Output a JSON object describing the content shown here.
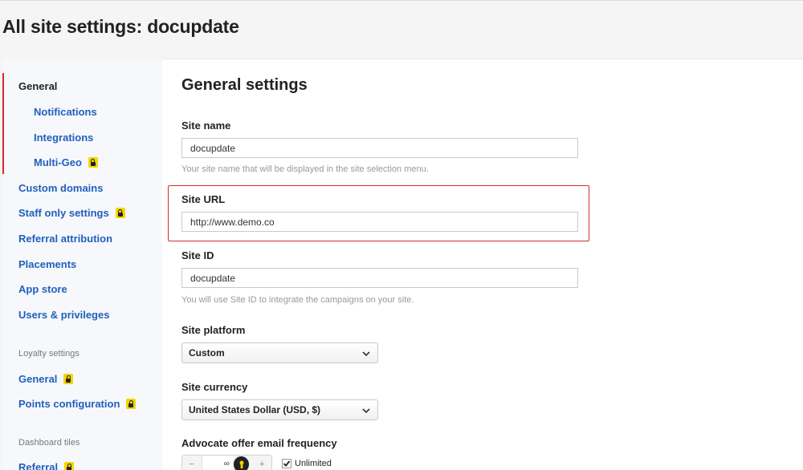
{
  "page": {
    "title": "All site settings: docupdate"
  },
  "sidebar": {
    "items": [
      {
        "label": "General",
        "current": true
      },
      {
        "label": "Notifications"
      },
      {
        "label": "Integrations"
      },
      {
        "label": "Multi-Geo",
        "locked": true
      },
      {
        "label": "Custom domains"
      },
      {
        "label": "Staff only settings",
        "locked": true
      },
      {
        "label": "Referral attribution"
      },
      {
        "label": "Placements"
      },
      {
        "label": "App store"
      },
      {
        "label": "Users & privileges"
      }
    ],
    "loyalty_section": "Loyalty settings",
    "loyalty_items": [
      {
        "label": "General",
        "locked": true
      },
      {
        "label": "Points configuration",
        "locked": true
      }
    ],
    "dashboard_section": "Dashboard tiles",
    "dashboard_items": [
      {
        "label": "Referral",
        "locked": true
      }
    ],
    "accent_color": "#d62b2b",
    "lock_icon": "lock-icon",
    "lock_color": "#f2d600"
  },
  "main": {
    "title": "General settings",
    "site_name": {
      "label": "Site name",
      "value": "docupdate",
      "help": "Your site name that will be displayed in the site selection menu."
    },
    "site_url": {
      "label": "Site URL",
      "value": "http://www.demo.co"
    },
    "site_id": {
      "label": "Site ID",
      "value": "docupdate",
      "help": "You will use Site ID to integrate the campaigns on your site."
    },
    "site_platform": {
      "label": "Site platform",
      "selected": "Custom"
    },
    "site_currency": {
      "label": "Site currency",
      "selected": "United States Dollar (USD, $)"
    },
    "email_frequency": {
      "label": "Advocate offer email frequency",
      "minus": "−",
      "value": "∞",
      "plus": "+",
      "unlimited_label": "Unlimited",
      "unlimited_checked": true
    }
  },
  "link_color": "#1f5fbf"
}
